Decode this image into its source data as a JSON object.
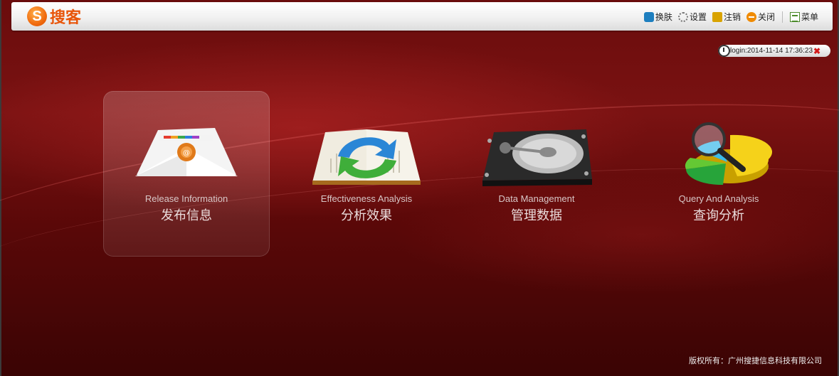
{
  "header": {
    "logo_text": "搜客",
    "tools": [
      {
        "label": "换肤",
        "icon": "skin-icon"
      },
      {
        "label": "设置",
        "icon": "gear-icon"
      },
      {
        "label": "注销",
        "icon": "lock-icon"
      },
      {
        "label": "关闭",
        "icon": "close-icon"
      },
      {
        "label": "菜单",
        "icon": "menu-icon"
      }
    ]
  },
  "login": {
    "text": "login:2014-11-14 17:36:23",
    "close": "✖"
  },
  "tiles": [
    {
      "en": "Release Information",
      "zh": "发布信息",
      "icon": "envelope-icon",
      "active": true
    },
    {
      "en": "Effectiveness Analysis",
      "zh": "分析效果",
      "icon": "refresh-book-icon",
      "active": false
    },
    {
      "en": "Data Management",
      "zh": "管理数据",
      "icon": "hard-disk-icon",
      "active": false
    },
    {
      "en": "Query And Analysis",
      "zh": "查询分析",
      "icon": "pie-chart-search-icon",
      "active": false
    }
  ],
  "footer": "版权所有：广州搜捷信息科技有限公司",
  "colors": {
    "background": "#6a0c0c",
    "accent": "#f06b0f"
  }
}
